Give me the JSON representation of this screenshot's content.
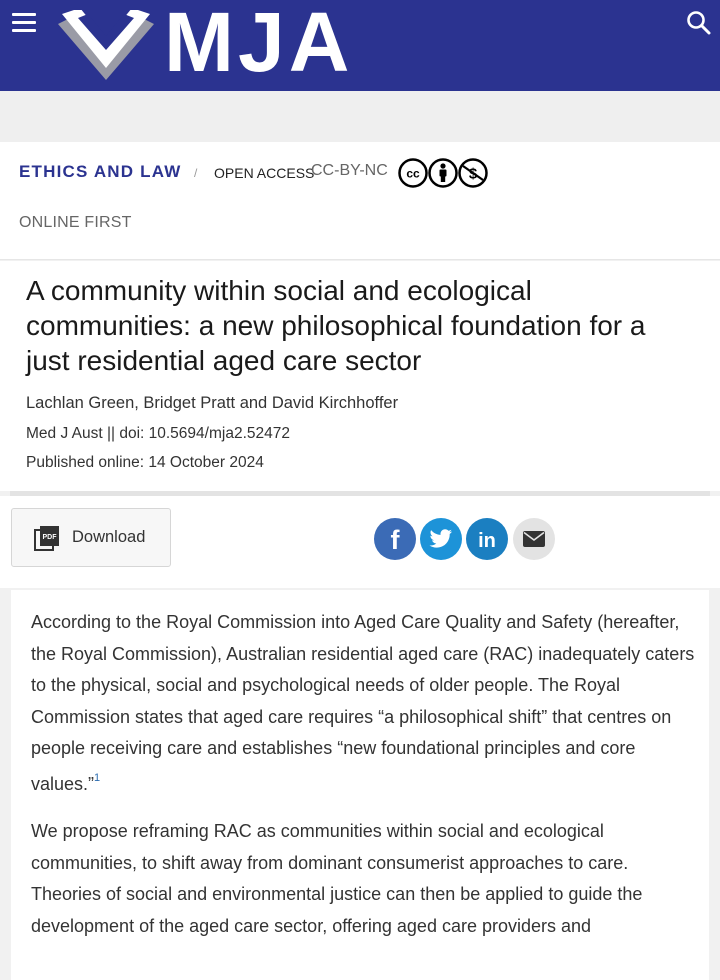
{
  "header": {
    "logo_text": "MJA",
    "icons": {
      "menu": "hamburger-menu-icon",
      "search": "search-icon"
    },
    "brand_color": "#2b3390"
  },
  "meta": {
    "category": "ETHICS AND LAW",
    "separator": "/",
    "open_access": "OPEN ACCESS",
    "license": "CC-BY-NC",
    "license_icons": [
      "cc-icon",
      "by-icon",
      "nc-icon"
    ],
    "status": "ONLINE FIRST"
  },
  "article": {
    "title": "A community within social and ecological communities: a new philosophical foundation for a just residential aged care sector",
    "authors": "Lachlan Green, Bridget Pratt and David Kirchhoffer",
    "citation": "Med J Aust || doi: 10.5694/mja2.52472",
    "published": "Published online: 14 October 2024"
  },
  "actions": {
    "download_label": "Download",
    "share": [
      {
        "name": "facebook-share-button",
        "icon": "facebook-icon",
        "color": "#3b6bb6"
      },
      {
        "name": "twitter-share-button",
        "icon": "twitter-icon",
        "color": "#1d93d8"
      },
      {
        "name": "linkedin-share-button",
        "icon": "linkedin-icon",
        "color": "#1b7fc1"
      },
      {
        "name": "email-share-button",
        "icon": "email-icon",
        "color": "#e3e3e3"
      }
    ]
  },
  "body": {
    "paragraph1_text": "According to the Royal Commission into Aged Care Quality and Safety (hereafter, the Royal Commission), Australian residential aged care (RAC) inadequately caters to the physical, social and psychological needs of older people. The Royal Commission states that aged care requires “a philosophical shift” that centres on people receiving care and establishes “new foundational principles and core values.”",
    "paragraph1_ref": "1",
    "paragraph2_text": "We propose reframing RAC as communities within social and ecological communities, to shift away from dominant consumerist approaches to care. Theories of social and environmental justice can then be applied to guide the development of the aged care sector, offering aged care providers and"
  }
}
